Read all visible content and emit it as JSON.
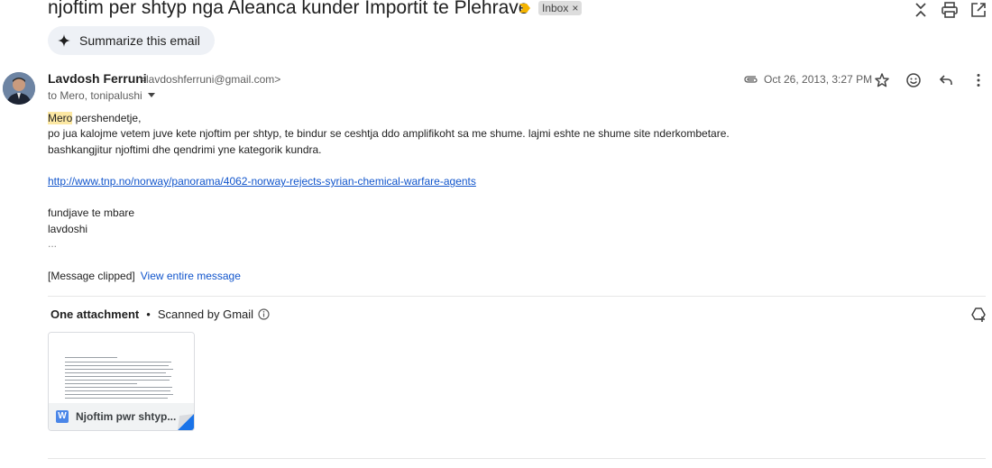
{
  "email": {
    "subject": "njoftim per shtyp nga Aleanca kunder Importit te Plehrave",
    "label": "Inbox",
    "label_remove": "×",
    "summarize_label": "Summarize this email",
    "sender_name": "Lavdosh Ferruni",
    "sender_email": "<lavdoshferruni@gmail.com>",
    "recipients": "to Mero, tonipalushi",
    "date": "Oct 26, 2013, 3:27 PM",
    "body": {
      "greeting_name": "Mero",
      "greeting_rest": " pershendetje,",
      "line2": "po jua kalojme vetem juve kete njoftim per shtyp, te bindur se ceshtja ddo amplifikoht sa me shume. lajmi eshte ne shume site nderkombetare.",
      "line3": "bashkangjitur njoftimi dhe qendrimi yne kategorik kundra.",
      "link": "http://www.tnp.no/norway/panorama/4062-norway-rejects-syrian-chemical-warfare-agents",
      "signoff": "fundjave te mbare",
      "signature": "lavdoshi",
      "ellipsis": "..."
    },
    "clipped_text": "[Message clipped]",
    "view_entire": "View entire message"
  },
  "attachments": {
    "title": "One attachment",
    "separator": "•",
    "scan_text": "Scanned by Gmail",
    "files": [
      {
        "name": "Njoftim pwr shtyp...",
        "type_letter": "W"
      }
    ]
  },
  "icons": {
    "importance": "importance-marker-icon",
    "collapse": "collapse-all-icon",
    "print": "print-icon",
    "open_new": "open-in-new-window-icon",
    "spark": "spark-icon",
    "attachment": "paperclip-icon",
    "star": "star-icon",
    "emoji": "emoji-icon",
    "reply": "reply-icon",
    "more": "more-vert-icon",
    "info": "info-icon",
    "add_to_drive": "add-to-drive-icon"
  },
  "colors": {
    "link": "#1155cc",
    "importance": "#f4b400",
    "highlight": "#fce8a3",
    "word_blue": "#4a86e8"
  }
}
